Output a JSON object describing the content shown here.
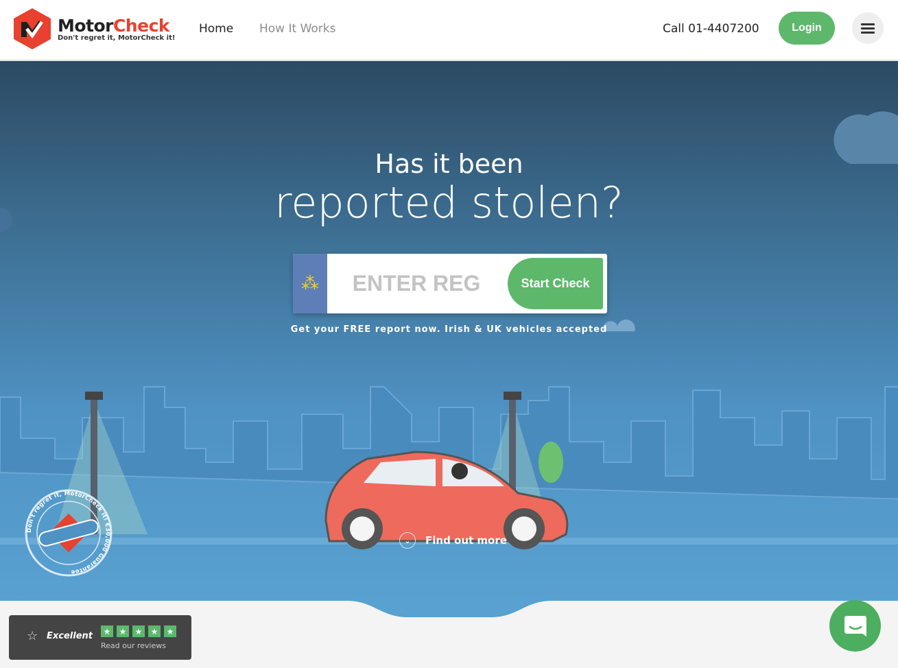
{
  "header": {
    "brand_main": "Motor",
    "brand_accent": "Check",
    "tagline": "Don't regret it, MotorCheck it!",
    "nav": [
      {
        "label": "Home"
      },
      {
        "label": "How It Works"
      }
    ],
    "phone": "Call 01-4407200",
    "login": "Login"
  },
  "hero": {
    "title_line1": "Has it been",
    "title_line2": "reported stolen?",
    "reg_placeholder": "ENTER REG",
    "start_button": "Start Check",
    "subtitle": "Get your FREE report now. Irish & UK vehicles accepted",
    "find_more": "Find out more",
    "badge_text": "Don't regret it, MotorCheck it! €30,000 Guarantee"
  },
  "trustpilot": {
    "rating": "Excellent",
    "stars": 5,
    "link": "Read our reviews"
  },
  "colors": {
    "accent": "#5db86b",
    "brand_red": "#e8412f"
  }
}
